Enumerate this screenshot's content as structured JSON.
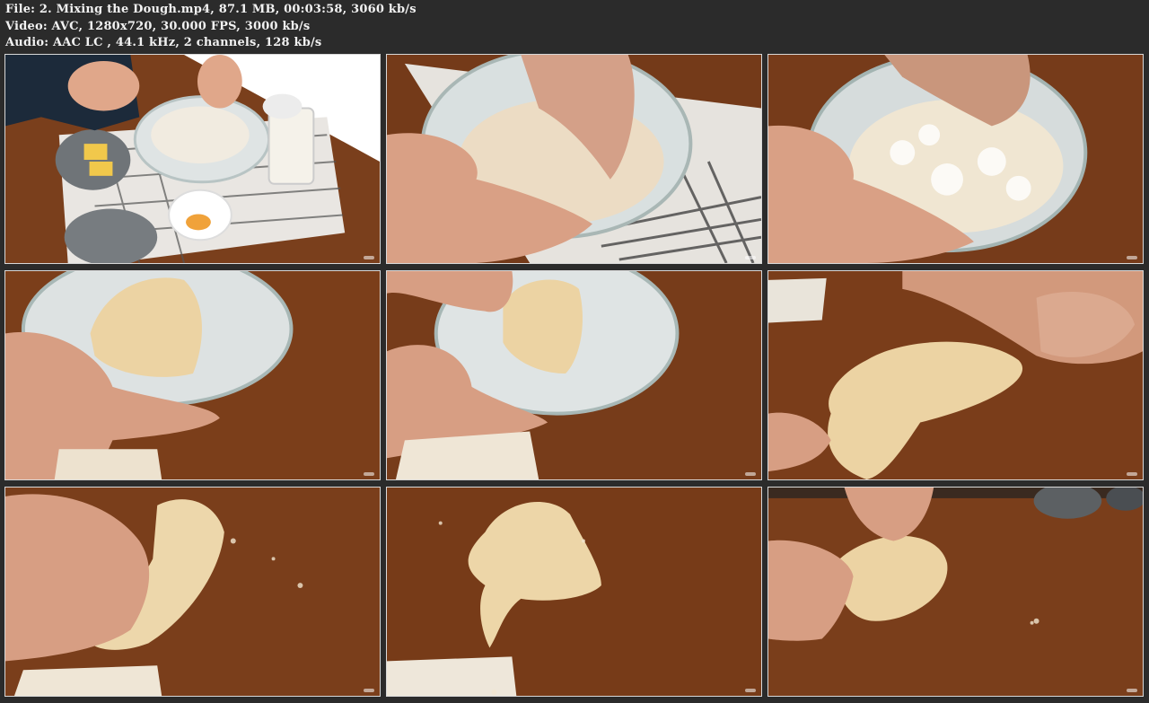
{
  "header": {
    "file_line": "File: 2. Mixing the Dough.mp4, 87.1 MB, 00:03:58, 3060 kb/s",
    "video_line": "Video: AVC, 1280x720, 30.000 FPS, 3000 kb/s",
    "audio_line": "Audio: AAC LC , 44.1 kHz, 2 channels, 128 kb/s"
  },
  "thumbnails": [
    {
      "scene": "ingredients-on-towel"
    },
    {
      "scene": "hand-mixing-flour-in-bowl"
    },
    {
      "scene": "shaggy-dough-in-bowl"
    },
    {
      "scene": "dough-clumps-in-bowl"
    },
    {
      "scene": "lifting-dough-from-bowl"
    },
    {
      "scene": "stretching-dough-on-table"
    },
    {
      "scene": "kneading-dough"
    },
    {
      "scene": "dough-rest-on-table"
    },
    {
      "scene": "shaping-dough-ball"
    }
  ],
  "colors": {
    "background": "#2b2b2b",
    "wood": "#6e3517",
    "dough": "#e8cf99"
  }
}
